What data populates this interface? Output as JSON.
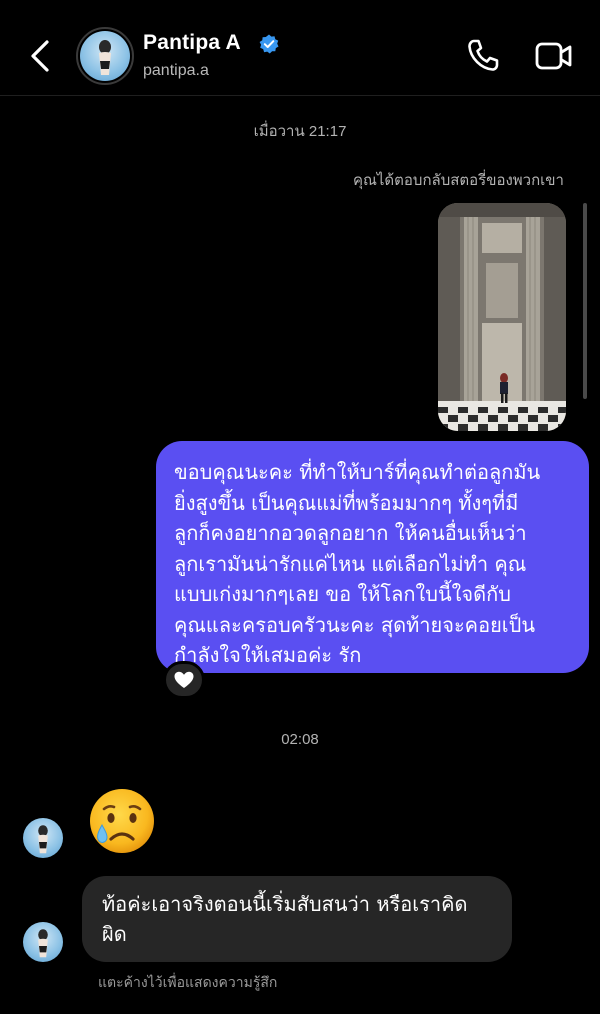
{
  "header": {
    "name": "Pantipa A",
    "username": "pantipa.a",
    "verified": true
  },
  "thread": {
    "time_1": "เมื่อวาน 21:17",
    "story_reply_note": "คุณได้ตอบกลับสตอรี่ของพวกเขา",
    "sent_message_lines": [
      "ขอบคุณนะคะ ที่ทำให้บาร์ที่คุณทำต่อลูกมัน",
      "ยิ่งสูงขึ้น เป็นคุณแม่ที่พร้อมมากๆ ทั้งๆที่มี",
      "ลูกก็คงอยากอวดลูกอยาก ให้คนอื่นเห็นว่า",
      "ลูกเรามันน่ารักแค่ไหน แต่เลือกไม่ทำ คุณ",
      "แบบเก่งมากๆเลย ขอ ให้โลกใบนี้ใจดีกับ",
      "คุณและครอบครัวนะคะ สุดท้ายจะคอยเป็น",
      "กำลังใจให้เสมอค่ะ รัก"
    ],
    "reaction": "heart",
    "time_2": "02:08",
    "received_emoji": "crying-face",
    "received_message_lines": [
      "ท้อค่ะเอาจริงตอนนี้เริ่มสับสนว่า หรือเราคิด",
      "ผิด"
    ],
    "hint": "แตะค้างไว้เพื่อแสดงความรู้สึก"
  },
  "colors": {
    "background": "#000000",
    "sent_bubble": "#5a4ff2",
    "received_bubble": "#262626",
    "verified_badge": "#3897f0"
  }
}
